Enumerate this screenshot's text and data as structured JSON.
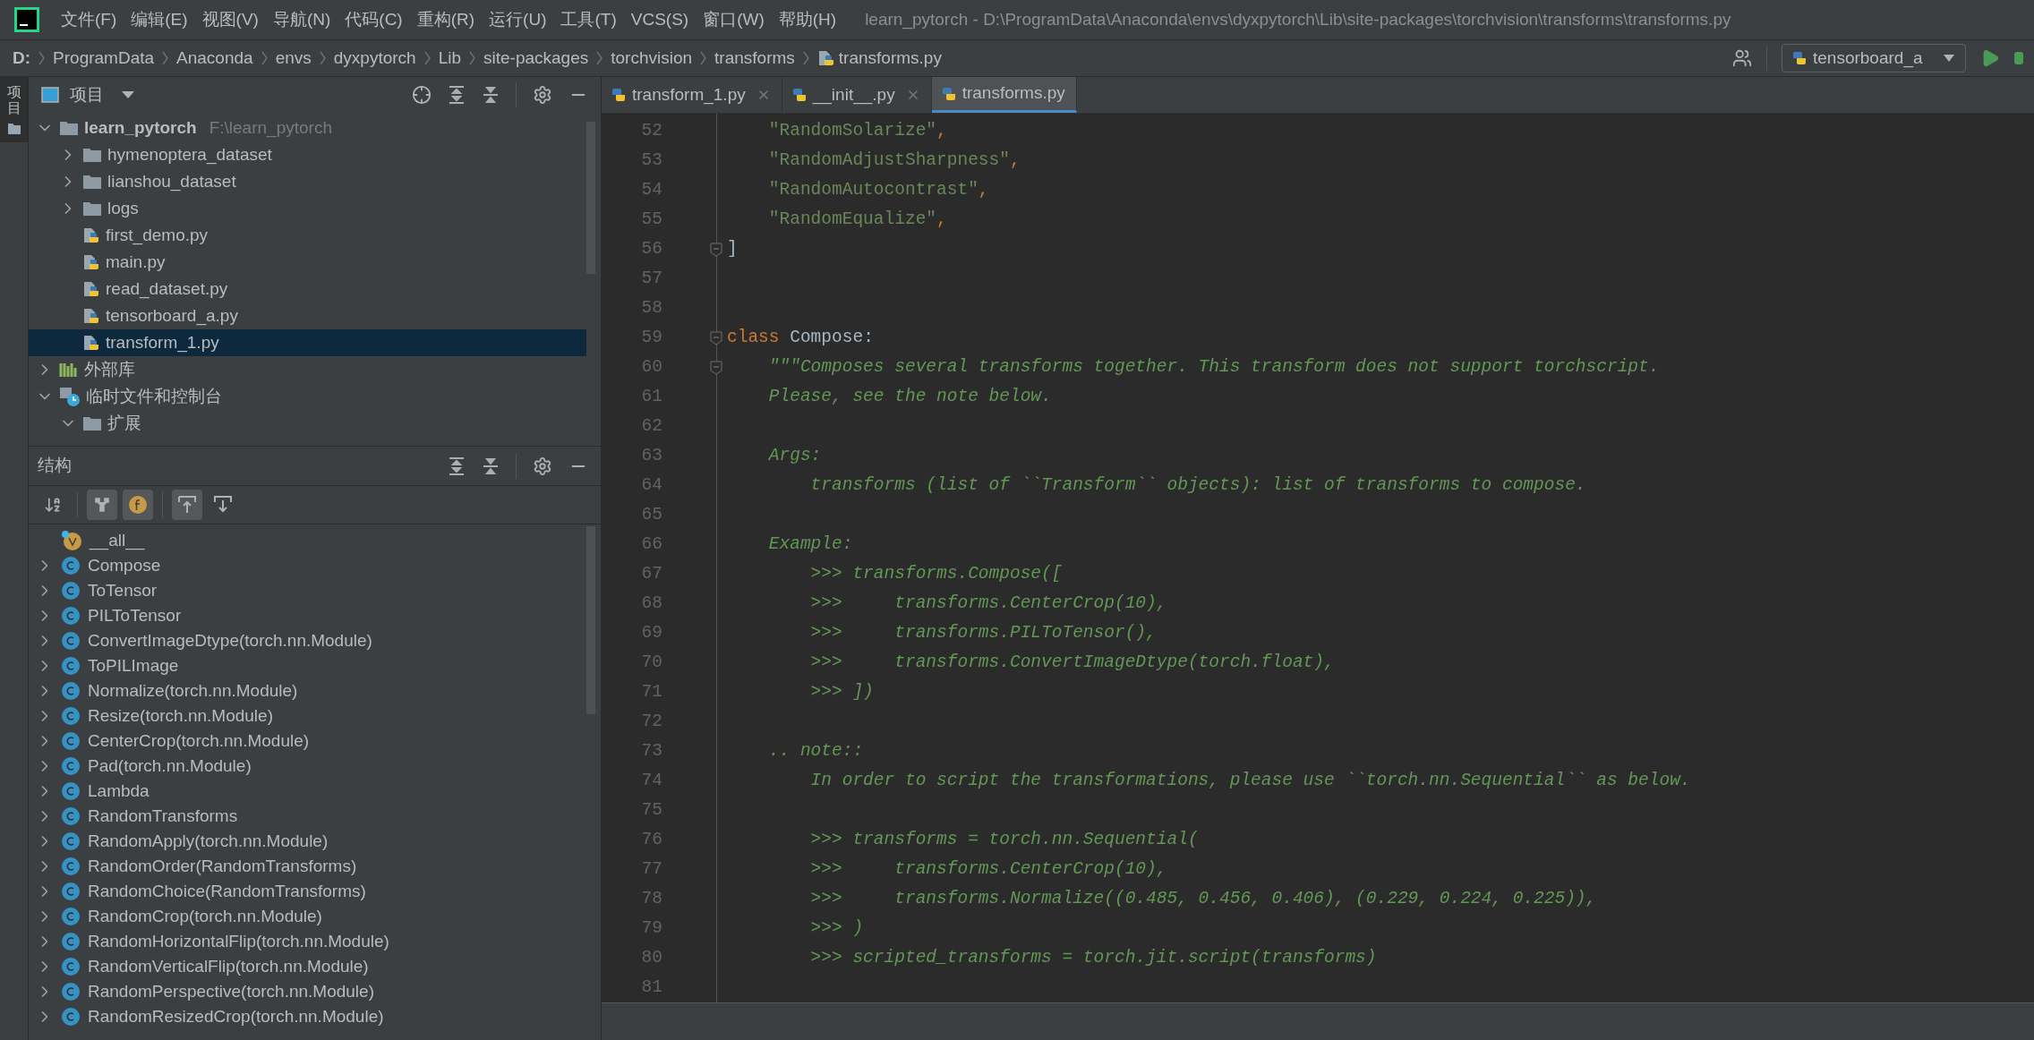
{
  "menu": [
    "文件(F)",
    "编辑(E)",
    "视图(V)",
    "导航(N)",
    "代码(C)",
    "重构(R)",
    "运行(U)",
    "工具(T)",
    "VCS(S)",
    "窗口(W)",
    "帮助(H)"
  ],
  "window": {
    "title": "learn_pytorch - D:\\ProgramData\\Anaconda\\envs\\dyxpytorch\\Lib\\site-packages\\torchvision\\transforms\\transforms.py"
  },
  "breadcrumb": [
    {
      "label": "D:",
      "kind": "drive"
    },
    {
      "label": "ProgramData",
      "kind": "folder"
    },
    {
      "label": "Anaconda",
      "kind": "folder"
    },
    {
      "label": "envs",
      "kind": "folder"
    },
    {
      "label": "dyxpytorch",
      "kind": "folder"
    },
    {
      "label": "Lib",
      "kind": "folder"
    },
    {
      "label": "site-packages",
      "kind": "folder"
    },
    {
      "label": "torchvision",
      "kind": "folder"
    },
    {
      "label": "transforms",
      "kind": "folder"
    },
    {
      "label": "transforms.py",
      "kind": "file"
    }
  ],
  "run_config": {
    "label": "tensorboard_a"
  },
  "side_strip": {
    "label": "项目"
  },
  "project": {
    "title": "项目",
    "tree": [
      {
        "label": "learn_pytorch",
        "path": "F:\\learn_pytorch",
        "kind": "root",
        "expanded": true,
        "selected": false,
        "children": [
          {
            "label": "hymenoptera_dataset",
            "kind": "folder",
            "expanded": false,
            "selected": false
          },
          {
            "label": "lianshou_dataset",
            "kind": "folder",
            "expanded": false,
            "selected": false
          },
          {
            "label": "logs",
            "kind": "folder",
            "expanded": false,
            "selected": false
          },
          {
            "label": "first_demo.py",
            "kind": "python",
            "selected": false
          },
          {
            "label": "main.py",
            "kind": "python",
            "selected": false
          },
          {
            "label": "read_dataset.py",
            "kind": "python",
            "selected": false
          },
          {
            "label": "tensorboard_a.py",
            "kind": "python",
            "selected": false
          },
          {
            "label": "transform_1.py",
            "kind": "python",
            "selected": true
          }
        ]
      },
      {
        "label": "外部库",
        "kind": "library",
        "expanded": false,
        "selected": false
      },
      {
        "label": "临时文件和控制台",
        "kind": "scratches",
        "expanded": true,
        "selected": false,
        "children": [
          {
            "label": "扩展",
            "kind": "folder",
            "expanded": true,
            "selected": false
          }
        ]
      }
    ]
  },
  "structure": {
    "title": "结构",
    "toolbar": [
      {
        "kind": "sort",
        "on": false
      },
      {
        "kind": "inherited",
        "on": true
      },
      {
        "kind": "fields",
        "on": true
      },
      {
        "kind": "scroll-to",
        "on": true
      },
      {
        "kind": "scroll-from",
        "on": false
      }
    ],
    "items": [
      {
        "label": "__all__",
        "kind": "variable"
      },
      {
        "label": "Compose",
        "kind": "class"
      },
      {
        "label": "ToTensor",
        "kind": "class"
      },
      {
        "label": "PILToTensor",
        "kind": "class"
      },
      {
        "label": "ConvertImageDtype(torch.nn.Module)",
        "kind": "class"
      },
      {
        "label": "ToPILImage",
        "kind": "class"
      },
      {
        "label": "Normalize(torch.nn.Module)",
        "kind": "class"
      },
      {
        "label": "Resize(torch.nn.Module)",
        "kind": "class"
      },
      {
        "label": "CenterCrop(torch.nn.Module)",
        "kind": "class"
      },
      {
        "label": "Pad(torch.nn.Module)",
        "kind": "class"
      },
      {
        "label": "Lambda",
        "kind": "class"
      },
      {
        "label": "RandomTransforms",
        "kind": "class"
      },
      {
        "label": "RandomApply(torch.nn.Module)",
        "kind": "class"
      },
      {
        "label": "RandomOrder(RandomTransforms)",
        "kind": "class"
      },
      {
        "label": "RandomChoice(RandomTransforms)",
        "kind": "class"
      },
      {
        "label": "RandomCrop(torch.nn.Module)",
        "kind": "class"
      },
      {
        "label": "RandomHorizontalFlip(torch.nn.Module)",
        "kind": "class"
      },
      {
        "label": "RandomVerticalFlip(torch.nn.Module)",
        "kind": "class"
      },
      {
        "label": "RandomPerspective(torch.nn.Module)",
        "kind": "class"
      },
      {
        "label": "RandomResizedCrop(torch.nn.Module)",
        "kind": "class"
      }
    ]
  },
  "tabs": [
    {
      "label": "transform_1.py",
      "selected": false
    },
    {
      "label": "__init__.py",
      "selected": false
    },
    {
      "label": "transforms.py",
      "selected": true
    }
  ],
  "code": [
    {
      "number": "52",
      "fold": false,
      "segments": [
        {
          "kind": "string",
          "text": "    \"RandomSolarize\""
        },
        {
          "kind": "punct",
          "text": ","
        }
      ]
    },
    {
      "number": "53",
      "fold": false,
      "segments": [
        {
          "kind": "string",
          "text": "    \"RandomAdjustSharpness\""
        },
        {
          "kind": "punct",
          "text": ","
        }
      ]
    },
    {
      "number": "54",
      "fold": false,
      "segments": [
        {
          "kind": "string",
          "text": "    \"RandomAutocontrast\""
        },
        {
          "kind": "punct",
          "text": ","
        }
      ]
    },
    {
      "number": "55",
      "fold": false,
      "segments": [
        {
          "kind": "string",
          "text": "    \"RandomEqualize\""
        },
        {
          "kind": "punct",
          "text": ","
        }
      ]
    },
    {
      "number": "56",
      "fold": true,
      "segments": [
        {
          "kind": "plain",
          "text": "]"
        }
      ]
    },
    {
      "number": "57",
      "fold": false
    },
    {
      "number": "58",
      "fold": false
    },
    {
      "number": "59",
      "fold": true,
      "segments": [
        {
          "kind": "keyword",
          "text": "class"
        },
        {
          "kind": "plain",
          "text": " Compose:"
        }
      ]
    },
    {
      "number": "60",
      "fold": true,
      "segments": [
        {
          "kind": "doc",
          "text": "    \"\"\"Composes several transforms together. This transform does not support torchscript."
        }
      ]
    },
    {
      "number": "61",
      "fold": false,
      "segments": [
        {
          "kind": "doc",
          "text": "    Please, see the note below."
        }
      ]
    },
    {
      "number": "62",
      "fold": false
    },
    {
      "number": "63",
      "fold": false,
      "segments": [
        {
          "kind": "doc",
          "text": "    Args:"
        }
      ]
    },
    {
      "number": "64",
      "fold": false,
      "segments": [
        {
          "kind": "doc",
          "text": "        transforms (list of ``Transform`` objects): list of transforms to compose."
        }
      ]
    },
    {
      "number": "65",
      "fold": false
    },
    {
      "number": "66",
      "fold": false,
      "segments": [
        {
          "kind": "doc",
          "text": "    Example:"
        }
      ]
    },
    {
      "number": "67",
      "fold": false,
      "segments": [
        {
          "kind": "doc",
          "text": "        >>> transforms.Compose(["
        }
      ]
    },
    {
      "number": "68",
      "fold": false,
      "segments": [
        {
          "kind": "doc",
          "text": "        >>>     transforms.CenterCrop(10),"
        }
      ]
    },
    {
      "number": "69",
      "fold": false,
      "segments": [
        {
          "kind": "doc",
          "text": "        >>>     transforms.PILToTensor(),"
        }
      ]
    },
    {
      "number": "70",
      "fold": false,
      "segments": [
        {
          "kind": "doc",
          "text": "        >>>     transforms.ConvertImageDtype(torch.float),"
        }
      ]
    },
    {
      "number": "71",
      "fold": false,
      "segments": [
        {
          "kind": "doc",
          "text": "        >>> ])"
        }
      ]
    },
    {
      "number": "72",
      "fold": false
    },
    {
      "number": "73",
      "fold": false,
      "segments": [
        {
          "kind": "doc",
          "text": "    .. note::"
        }
      ]
    },
    {
      "number": "74",
      "fold": false,
      "segments": [
        {
          "kind": "doc",
          "text": "        In order to script the transformations, please use ``torch.nn.Sequential`` as below."
        }
      ]
    },
    {
      "number": "75",
      "fold": false
    },
    {
      "number": "76",
      "fold": false,
      "segments": [
        {
          "kind": "doc",
          "text": "        >>> transforms = torch.nn.Sequential("
        }
      ]
    },
    {
      "number": "77",
      "fold": false,
      "segments": [
        {
          "kind": "doc",
          "text": "        >>>     transforms.CenterCrop(10),"
        }
      ]
    },
    {
      "number": "78",
      "fold": false,
      "segments": [
        {
          "kind": "doc",
          "text": "        >>>     transforms.Normalize((0.485, 0.456, 0.406), (0.229, 0.224, 0.225)),"
        }
      ]
    },
    {
      "number": "79",
      "fold": false,
      "segments": [
        {
          "kind": "doc",
          "text": "        >>> )"
        }
      ]
    },
    {
      "number": "80",
      "fold": false,
      "segments": [
        {
          "kind": "doc",
          "text": "        >>> scripted_transforms = torch.jit.script(transforms)"
        }
      ]
    },
    {
      "number": "81",
      "fold": false
    }
  ]
}
